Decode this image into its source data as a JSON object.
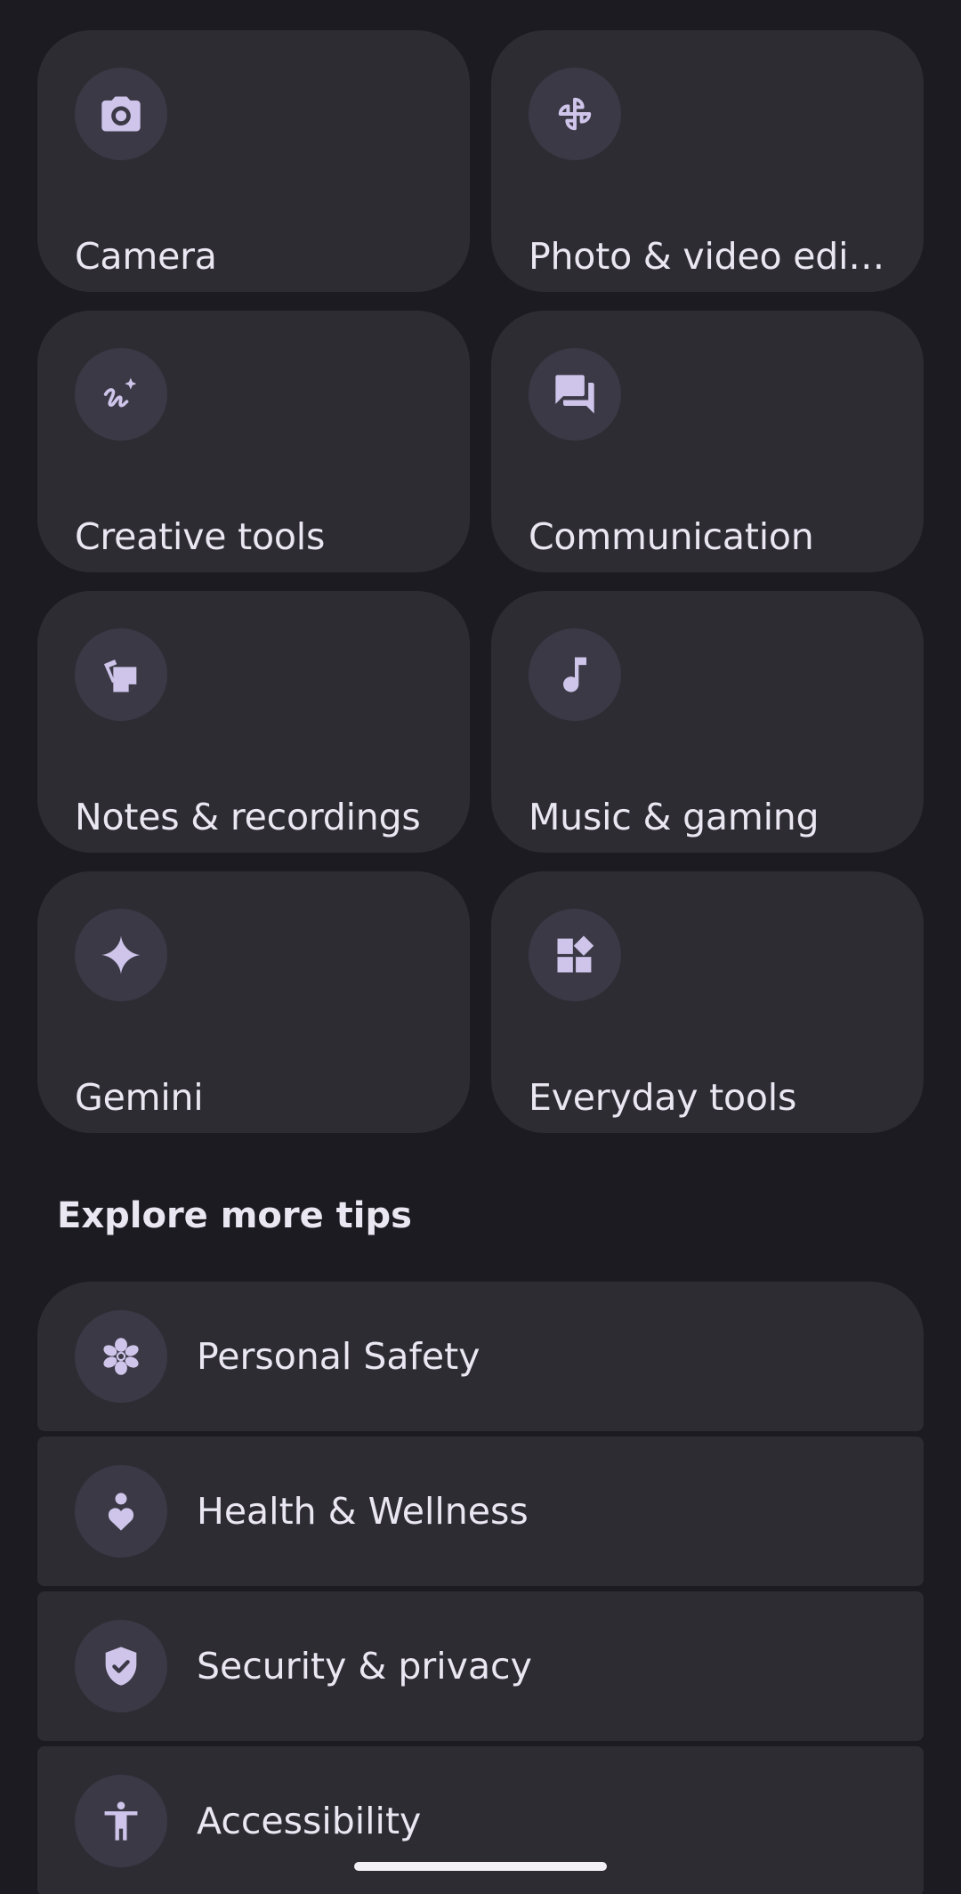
{
  "categories": [
    {
      "label": "Camera",
      "icon": "camera-icon"
    },
    {
      "label": "Photo & video edit…",
      "icon": "pinwheel-icon"
    },
    {
      "label": "Creative tools",
      "icon": "creative-sparkle-icon"
    },
    {
      "label": "Communication",
      "icon": "chat-bubbles-icon"
    },
    {
      "label": "Notes & recordings",
      "icon": "notes-stack-icon"
    },
    {
      "label": "Music & gaming",
      "icon": "music-note-icon"
    },
    {
      "label": "Gemini",
      "icon": "gemini-sparkle-icon"
    },
    {
      "label": "Everyday tools",
      "icon": "widgets-icon"
    }
  ],
  "explore": {
    "title": "Explore more tips",
    "items": [
      {
        "label": "Personal Safety",
        "icon": "personal-safety-icon"
      },
      {
        "label": "Health & Wellness",
        "icon": "health-person-heart-icon"
      },
      {
        "label": "Security & privacy",
        "icon": "shield-check-icon"
      },
      {
        "label": "Accessibility",
        "icon": "accessibility-icon"
      }
    ]
  },
  "colors": {
    "background": "#1c1b21",
    "card": "#2d2c33",
    "icon_circle": "#3b3946",
    "icon": "#cfc5ea",
    "text": "#ebe7f2"
  }
}
